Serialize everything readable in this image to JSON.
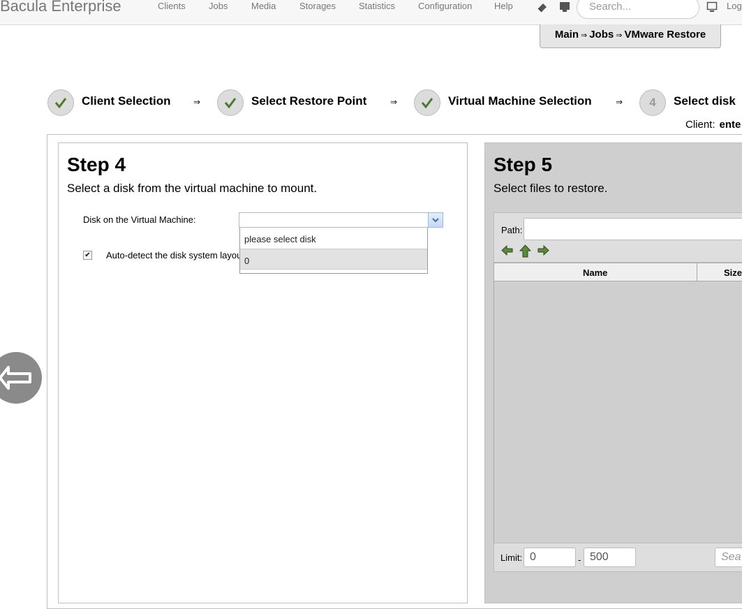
{
  "header": {
    "brand": "Bacula Enterprise",
    "nav": [
      "Clients",
      "Jobs",
      "Media",
      "Storages",
      "Statistics",
      "Configuration",
      "Help"
    ],
    "search_placeholder": "Search...",
    "logout_label": "Log",
    "icons": [
      "eraser-icon",
      "monitor-icon",
      "user-monitor-icon"
    ]
  },
  "breadcrumb": {
    "items": [
      "Main",
      "Jobs",
      "VMware Restore"
    ],
    "separator": "⇒"
  },
  "wizard": {
    "steps": [
      {
        "label": "Client Selection",
        "state": "done"
      },
      {
        "label": "Select Restore Point",
        "state": "done"
      },
      {
        "label": "Virtual Machine Selection",
        "state": "done"
      },
      {
        "label": "Select disk",
        "number": "4",
        "state": "current"
      }
    ],
    "arrow": "⇒",
    "client_label": "Client:",
    "client_value": "ente"
  },
  "step4": {
    "title": "Step 4",
    "description": "Select a disk from the virtual machine to mount.",
    "disk_label": "Disk on the Virtual Machine:",
    "disk_value": "",
    "disk_options": [
      "please select disk",
      "0"
    ],
    "disk_highlighted": "0",
    "autodetect_label": "Auto-detect the disk system layou",
    "autodetect_checked": true
  },
  "step5": {
    "title": "Step 5",
    "description": "Select files to restore.",
    "path_label": "Path:",
    "path_value": "",
    "columns": [
      "Name",
      "Size"
    ],
    "limit_label": "Limit:",
    "limit_from": "0",
    "limit_sep": "-",
    "limit_to": "500",
    "search_placeholder": "Sea"
  },
  "colors": {
    "check_green": "#4a7a2c",
    "nav_arrow_green": "#5a8a3a",
    "panel_gray": "#cfcfcf"
  }
}
